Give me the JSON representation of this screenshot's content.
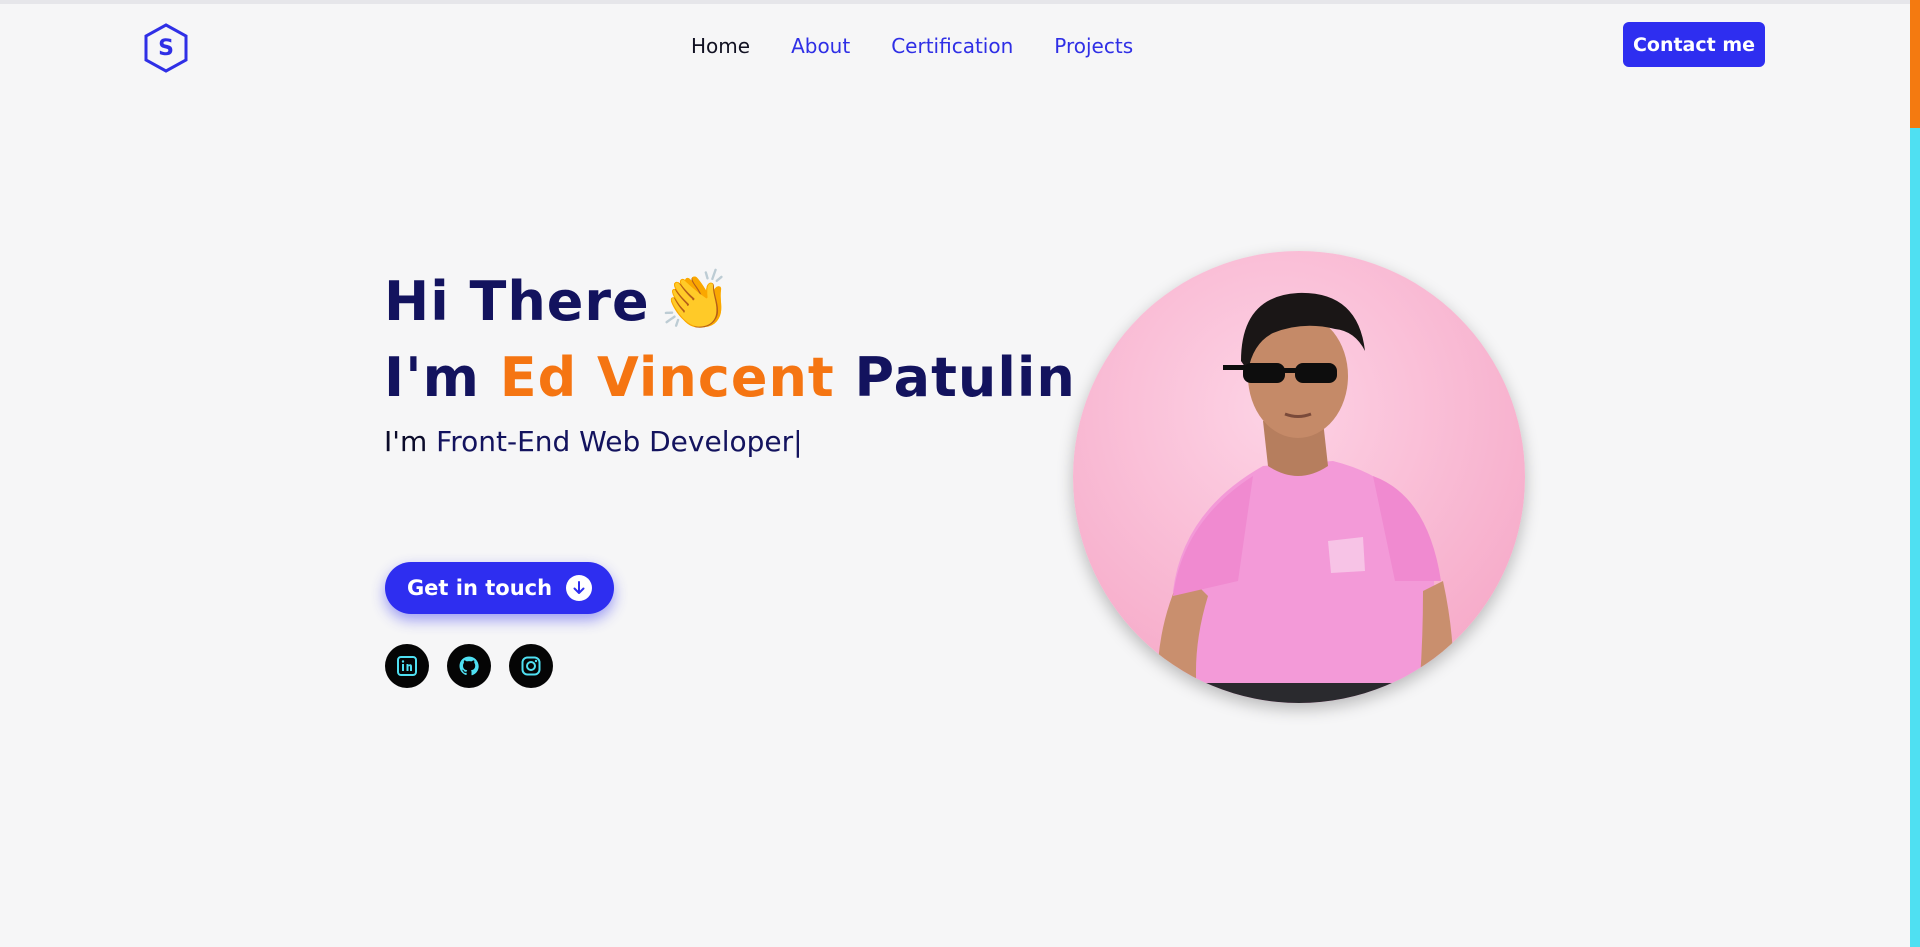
{
  "nav": {
    "logo_letter": "S",
    "links": [
      {
        "label": "Home",
        "active": true
      },
      {
        "label": "About",
        "active": false
      },
      {
        "label": "Certification",
        "active": false
      },
      {
        "label": "Projects",
        "active": false
      }
    ],
    "contact_label": "Contact me"
  },
  "hero": {
    "greeting": "Hi There",
    "wave_emoji": "👏",
    "name_prefix": "I'm ",
    "name_highlight": "Ed Vincent",
    "name_suffix": " Patulin",
    "role_prefix": "I'm ",
    "role_text": "Front-End Web Developer",
    "cursor": "|",
    "cta_label": "Get in touch",
    "cta_icon": "arrow-down-circle-icon"
  },
  "socials": [
    {
      "name": "linkedin-icon"
    },
    {
      "name": "github-icon"
    },
    {
      "name": "instagram-icon"
    }
  ],
  "profile_image": "portrait-photo",
  "colors": {
    "primary": "#2e2ef0",
    "heading": "#13135e",
    "accent": "#f57512",
    "background": "#f6f6f7",
    "icon_accent": "#4fe0f2",
    "photo_background": "#fcc5dc"
  },
  "scrollbar": {
    "thumb_color": "#f47a10",
    "track_color": "#4fe0f2"
  }
}
